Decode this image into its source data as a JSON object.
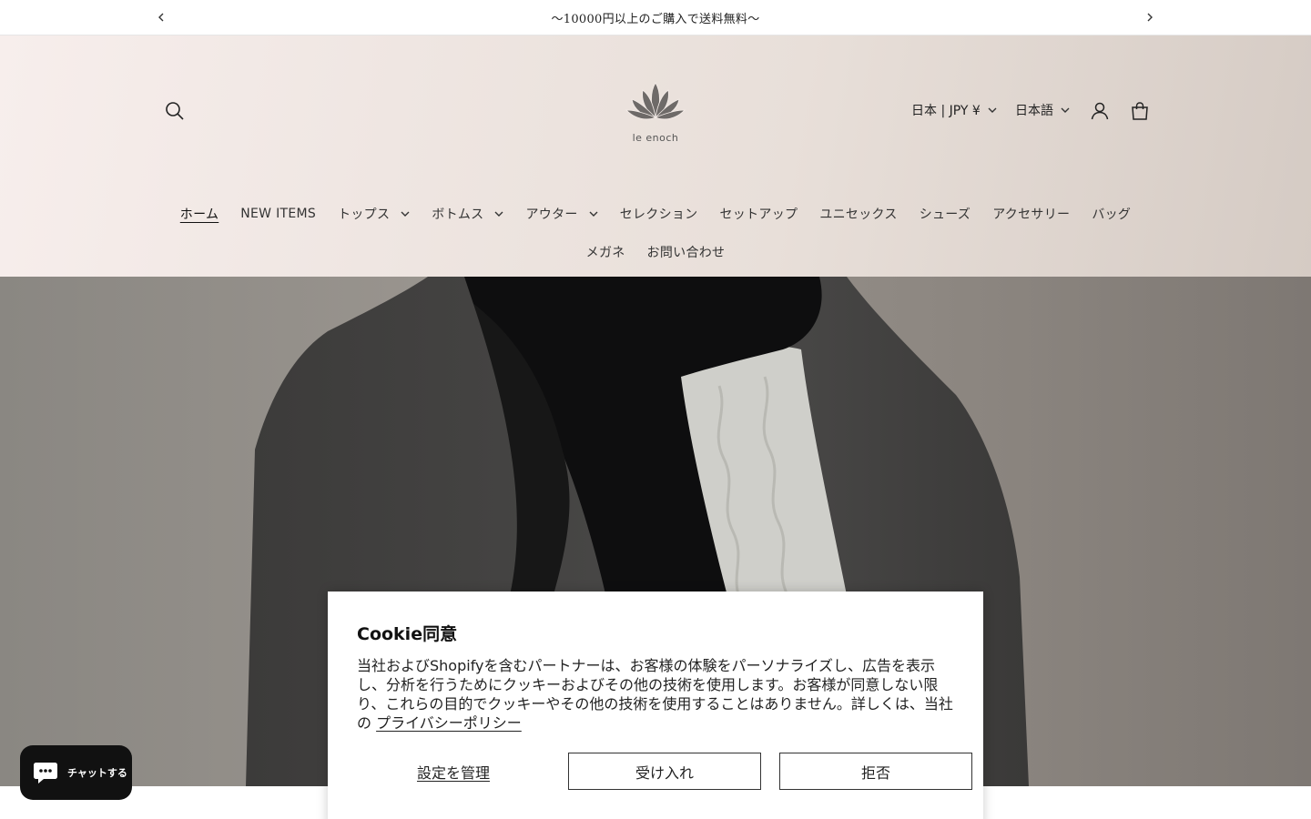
{
  "announcement": {
    "text": "〜10000円以上のご購入で送料無料〜"
  },
  "header": {
    "logo_text": "le enoch",
    "country_selector": "日本 | JPY ¥",
    "language_selector": "日本語"
  },
  "nav": {
    "row1": [
      {
        "label": "ホーム",
        "active": true,
        "dropdown": false
      },
      {
        "label": "NEW ITEMS",
        "dropdown": false
      },
      {
        "label": "トップス",
        "dropdown": true
      },
      {
        "label": "ボトムス",
        "dropdown": true
      },
      {
        "label": "アウター",
        "dropdown": true
      },
      {
        "label": "セレクション",
        "dropdown": false
      },
      {
        "label": "セットアップ",
        "dropdown": false
      },
      {
        "label": "ユニセックス",
        "dropdown": false
      },
      {
        "label": "シューズ",
        "dropdown": false
      },
      {
        "label": "アクセサリー",
        "dropdown": false
      },
      {
        "label": "バッグ",
        "dropdown": false
      }
    ],
    "row2": [
      {
        "label": "メガネ",
        "dropdown": false
      },
      {
        "label": "お問い合わせ",
        "dropdown": false
      }
    ]
  },
  "cookie": {
    "title": "Cookie同意",
    "body": "当社およびShopifyを含むパートナーは、お客様の体験をパーソナライズし、広告を表示し、分析を行うためにクッキーおよびその他の技術を使用します。お客様が同意しない限り、これらの目的でクッキーやその他の技術を使用することはありません。詳しくは、当社の ",
    "privacy_link": "プライバシーポリシー",
    "manage_label": "設定を管理",
    "accept_label": "受け入れ",
    "decline_label": "拒否"
  },
  "chat": {
    "label": "チャットする"
  },
  "colors": {
    "chat_bg": "#111111",
    "header_gradient_start": "#f7eeec",
    "header_gradient_end": "#d5cbc4"
  }
}
